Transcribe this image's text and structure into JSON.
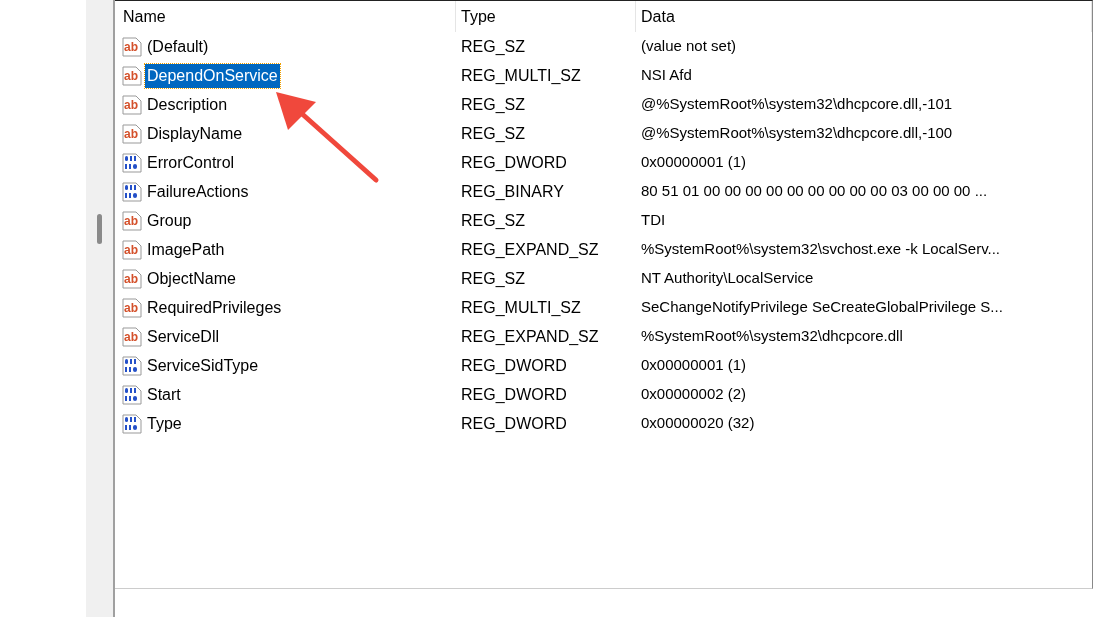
{
  "table": {
    "columns": [
      "Name",
      "Type",
      "Data"
    ],
    "rows": [
      {
        "kind": "string",
        "icon_text": "ab",
        "name": "(Default)",
        "type": "REG_SZ",
        "data": "(value not set)",
        "selected": false
      },
      {
        "kind": "string",
        "icon_text": "ab",
        "name": "DependOnService",
        "type": "REG_MULTI_SZ",
        "data": "NSI Afd",
        "selected": true
      },
      {
        "kind": "string",
        "icon_text": "ab",
        "name": "Description",
        "type": "REG_SZ",
        "data": "@%SystemRoot%\\system32\\dhcpcore.dll,-101",
        "selected": false
      },
      {
        "kind": "string",
        "icon_text": "ab",
        "name": "DisplayName",
        "type": "REG_SZ",
        "data": "@%SystemRoot%\\system32\\dhcpcore.dll,-100",
        "selected": false
      },
      {
        "kind": "binary",
        "name": "ErrorControl",
        "type": "REG_DWORD",
        "data": "0x00000001 (1)",
        "selected": false
      },
      {
        "kind": "binary",
        "name": "FailureActions",
        "type": "REG_BINARY",
        "data": "80 51 01 00 00 00 00 00 00 00 00 00 03 00 00 00 ...",
        "selected": false
      },
      {
        "kind": "string",
        "icon_text": "ab",
        "name": "Group",
        "type": "REG_SZ",
        "data": "TDI",
        "selected": false
      },
      {
        "kind": "string",
        "icon_text": "ab",
        "name": "ImagePath",
        "type": "REG_EXPAND_SZ",
        "data": "%SystemRoot%\\system32\\svchost.exe -k LocalServ...",
        "selected": false
      },
      {
        "kind": "string",
        "icon_text": "ab",
        "name": "ObjectName",
        "type": "REG_SZ",
        "data": "NT Authority\\LocalService",
        "selected": false
      },
      {
        "kind": "string",
        "icon_text": "ab",
        "name": "RequiredPrivileges",
        "type": "REG_MULTI_SZ",
        "data": "SeChangeNotifyPrivilege SeCreateGlobalPrivilege S...",
        "selected": false
      },
      {
        "kind": "string",
        "icon_text": "ab",
        "name": "ServiceDll",
        "type": "REG_EXPAND_SZ",
        "data": "%SystemRoot%\\system32\\dhcpcore.dll",
        "selected": false
      },
      {
        "kind": "binary",
        "name": "ServiceSidType",
        "type": "REG_DWORD",
        "data": "0x00000001 (1)",
        "selected": false
      },
      {
        "kind": "binary",
        "name": "Start",
        "type": "REG_DWORD",
        "data": "0x00000002 (2)",
        "selected": false
      },
      {
        "kind": "binary",
        "name": "Type",
        "type": "REG_DWORD",
        "data": "0x00000020 (32)",
        "selected": false
      }
    ]
  }
}
